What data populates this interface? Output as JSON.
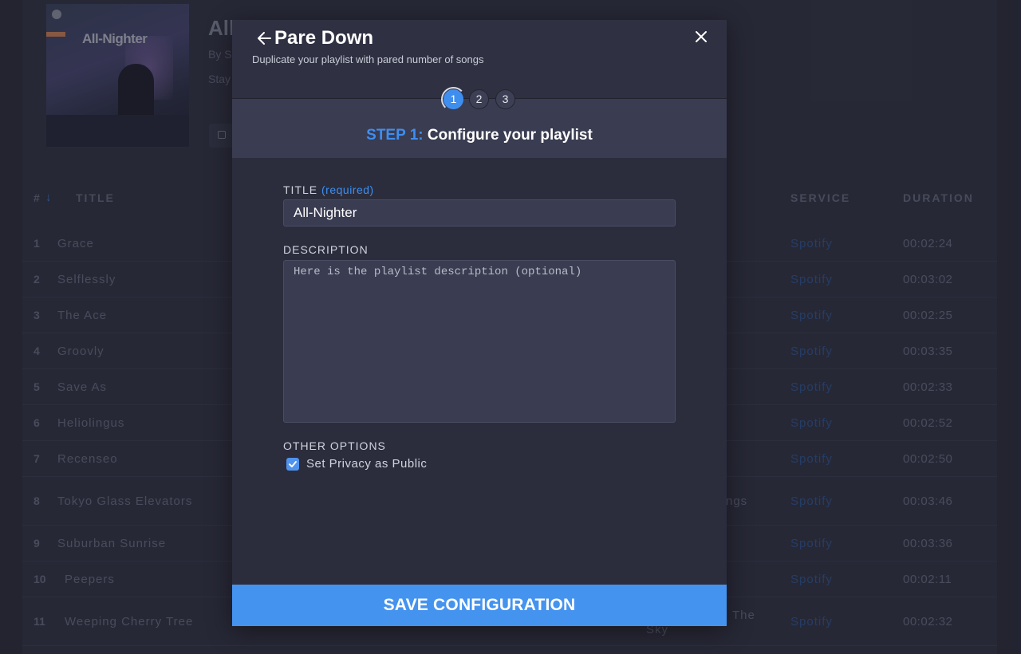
{
  "background": {
    "cover_title": "All-Nighter",
    "playlist_title_partial": "All",
    "by_partial": "By S",
    "stay_partial": "Stay",
    "headers": {
      "num": "#",
      "title": "TITLE",
      "service": "SERVICE",
      "duration": "DURATION"
    },
    "tracks": [
      {
        "num": "1",
        "title": "Grace",
        "service": "Spotify",
        "duration": "00:02:24"
      },
      {
        "num": "2",
        "title": "Selflessly",
        "service": "Spotify",
        "duration": "00:03:02"
      },
      {
        "num": "3",
        "title": "The Ace",
        "service": "Spotify",
        "duration": "00:02:25"
      },
      {
        "num": "4",
        "title": "Groovly",
        "service": "Spotify",
        "duration": "00:03:35"
      },
      {
        "num": "5",
        "title": "Save As",
        "service": "Spotify",
        "duration": "00:02:33"
      },
      {
        "num": "6",
        "title": "Heliolingus",
        "service": "Spotify",
        "duration": "00:02:52"
      },
      {
        "num": "7",
        "title": "Recenseo",
        "service": "Spotify",
        "duration": "00:02:50"
      },
      {
        "num": "8",
        "title": "Tokyo Glass Elevators",
        "extra": "ngs",
        "service": "Spotify",
        "duration": "00:03:46"
      },
      {
        "num": "9",
        "title": "Suburban Sunrise",
        "service": "Spotify",
        "duration": "00:03:36"
      },
      {
        "num": "10",
        "title": "Peepers",
        "service": "Spotify",
        "duration": "00:02:11"
      },
      {
        "num": "11",
        "title": "Weeping Cherry Tree",
        "extra": "The",
        "extra2": "Sky",
        "service": "Spotify",
        "duration": "00:02:32"
      }
    ]
  },
  "modal": {
    "title": "Pare Down",
    "subtitle": "Duplicate your playlist with pared number of songs",
    "steps": [
      "1",
      "2",
      "3"
    ],
    "active_step": 1,
    "step_label": "STEP 1:",
    "step_heading": "Configure your playlist",
    "title_label": "TITLE",
    "title_required": "(required)",
    "title_value": "All-Nighter",
    "description_label": "DESCRIPTION",
    "description_placeholder": "Here is the playlist description (optional)",
    "other_options_label": "OTHER OPTIONS",
    "privacy_label": "Set Privacy as Public",
    "privacy_checked": true,
    "save_label": "SAVE CONFIGURATION"
  },
  "colors": {
    "accent": "#3e8ef0",
    "save_button": "#4493ef",
    "modal_bg": "#2b2d3d"
  }
}
